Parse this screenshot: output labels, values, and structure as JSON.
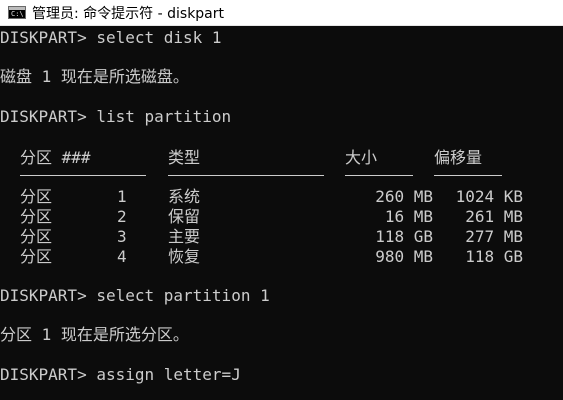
{
  "window": {
    "title": "管理员: 命令提示符 - diskpart",
    "icon_glyph": "C:\\"
  },
  "console": {
    "lines": [
      "DISKPART> select disk 1",
      "磁盘 1 现在是所选磁盘。",
      "DISKPART> list partition",
      "DISKPART> select partition 1",
      "分区 1 现在是所选分区。",
      "DISKPART> assign letter=J"
    ],
    "table": {
      "headers": [
        "分区 ###",
        "类型",
        "大小",
        "偏移量"
      ],
      "rows": [
        [
          "分区",
          "1",
          "系统",
          "260 MB",
          "1024 KB"
        ],
        [
          "分区",
          "2",
          "保留",
          "16 MB",
          "261 MB"
        ],
        [
          "分区",
          "3",
          "主要",
          "118 GB",
          "277 MB"
        ],
        [
          "分区",
          "4",
          "恢复",
          "980 MB",
          "118 GB"
        ]
      ]
    }
  }
}
